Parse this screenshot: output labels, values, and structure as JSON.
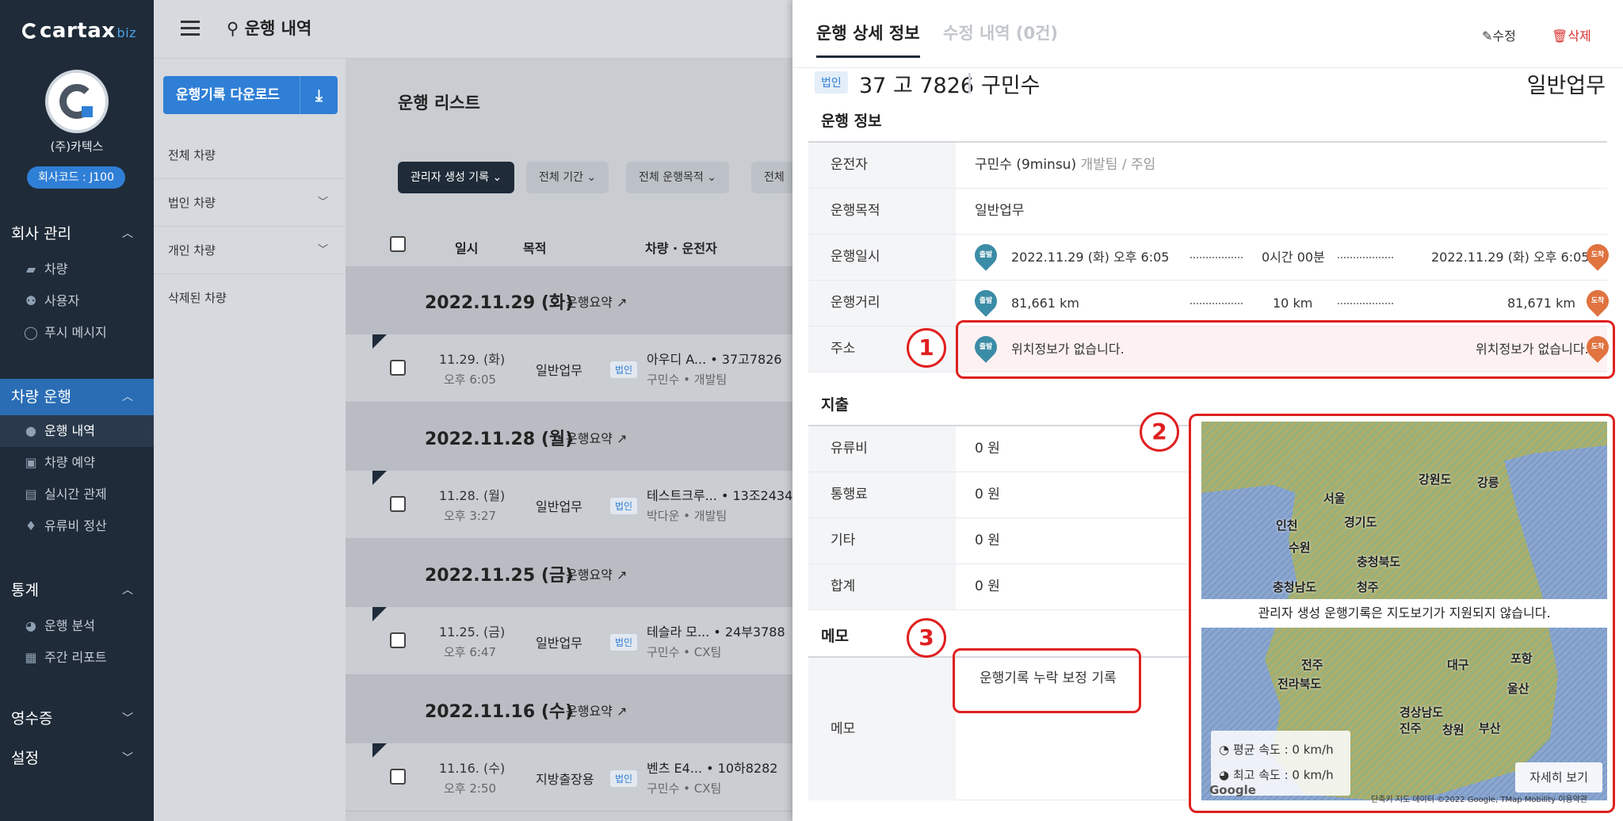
{
  "sidebar": {
    "logo": "cartax",
    "logo_suffix": "biz",
    "company": "(주)카텍스",
    "company_code": "회사코드 : J100",
    "sections": {
      "company_mgmt": "회사 관리",
      "vehicle_ops": "차량 운행",
      "stats": "통계",
      "receipts": "영수증",
      "settings": "설정"
    },
    "items": {
      "vehicle": "차량",
      "users": "사용자",
      "push": "푸시 메시지",
      "drive_log": "운행 내역",
      "reserve": "차량 예약",
      "realtime": "실시간 관제",
      "fuel": "유류비 정산",
      "analysis": "운행 분석",
      "weekly": "주간 리포트"
    }
  },
  "topbar": {
    "breadcrumb": "운행 내역"
  },
  "midcol": {
    "download": "운행기록 다운로드",
    "filters": [
      "전체 차량",
      "법인 차량",
      "개인 차량",
      "삭제된 차량"
    ]
  },
  "list": {
    "title": "운행 리스트",
    "filter_buttons": [
      "관리자 생성 기록",
      "전체 기간",
      "전체 운행목적",
      "전체 부"
    ],
    "columns": [
      "일시",
      "목적",
      "차량 · 운전자"
    ],
    "summary_label": "운행요약",
    "groups": [
      {
        "date": "2022.11.29 (화)",
        "row": {
          "date": "11.29. (화)",
          "time": "오후 6:05",
          "purpose": "일반업무",
          "badge": "법인",
          "car": "아우디 A... • 37고7826",
          "driver": "구민수 • 개발팀"
        }
      },
      {
        "date": "2022.11.28 (월)",
        "row": {
          "date": "11.28. (월)",
          "time": "오후 3:27",
          "purpose": "일반업무",
          "badge": "법인",
          "car": "테스트크루... • 13조2434",
          "driver": "박다운 • 개발팀"
        }
      },
      {
        "date": "2022.11.25 (금)",
        "row": {
          "date": "11.25. (금)",
          "time": "오후 6:47",
          "purpose": "일반업무",
          "badge": "법인",
          "car": "테슬라 모... • 24부3788",
          "driver": "구민수 • CX팀"
        }
      },
      {
        "date": "2022.11.16 (수)",
        "row": {
          "date": "11.16. (수)",
          "time": "오후 2:50",
          "purpose": "지방출장용",
          "badge": "법인",
          "car": "벤츠 E4... • 10하8282",
          "driver": "구민수 • CX팀"
        }
      }
    ]
  },
  "panel": {
    "tab_detail": "운행 상세 정보",
    "tab_edits": "수정 내역 (0건)",
    "edit": "수정",
    "delete": "삭제",
    "badge": "법인",
    "plate": "37 고 7826",
    "driver": "구민수",
    "purpose": "일반업무",
    "sec_drive": "운행 정보",
    "rows": {
      "driver_label": "운전자",
      "driver_value": "구민수 (9minsu)",
      "driver_sub": "개발팀 / 주임",
      "purpose_label": "운행목적",
      "purpose_value": "일반업무",
      "datetime_label": "운행일시",
      "dep_time": "2022.11.29 (화) 오후 6:05",
      "duration": "0시간 00분",
      "arr_time": "2022.11.29 (화) 오후 6:05",
      "distance_label": "운행거리",
      "dep_km": "81,661 km",
      "km": "10 km",
      "arr_km": "81,671 km",
      "address_label": "주소",
      "dep_addr": "위치정보가 없습니다.",
      "arr_addr": "위치정보가 없습니다."
    },
    "pin_dep": "출발",
    "pin_arr": "도착",
    "sec_expense": "지출",
    "expenses": [
      {
        "label": "유류비",
        "value": "0 원"
      },
      {
        "label": "통행료",
        "value": "0 원"
      },
      {
        "label": "기타",
        "value": "0 원"
      },
      {
        "label": "합계",
        "value": "0 원"
      }
    ],
    "sec_memo": "메모",
    "memo_label": "메모",
    "memo_value": "운행기록 누락 보정 기록",
    "map": {
      "note": "관리자 생성 운행기록은 지도보기가 지원되지 않습니다.",
      "avg_speed": "평균 속도 : 0 km/h",
      "max_speed": "최고 속도 : 0 km/h",
      "more": "자세히 보기",
      "google": "Google",
      "copyright": "단축키 지도 데이터 ©2022 Google, TMap Mobility 이용약관",
      "labels": [
        "서울",
        "인천",
        "수원",
        "경기도",
        "강원도",
        "강릉",
        "충청북도",
        "충청남도",
        "청주",
        "전주",
        "전라북도",
        "대구",
        "포항",
        "울산",
        "경상남도",
        "진주",
        "창원",
        "부산"
      ]
    }
  },
  "annotations": [
    "1",
    "2",
    "3"
  ],
  "colors": {
    "sidebar": "#1f2b38",
    "accent": "#2f7fd6",
    "departure": "#3b8ca6",
    "arrival": "#e07340",
    "annotation": "#e02020"
  }
}
